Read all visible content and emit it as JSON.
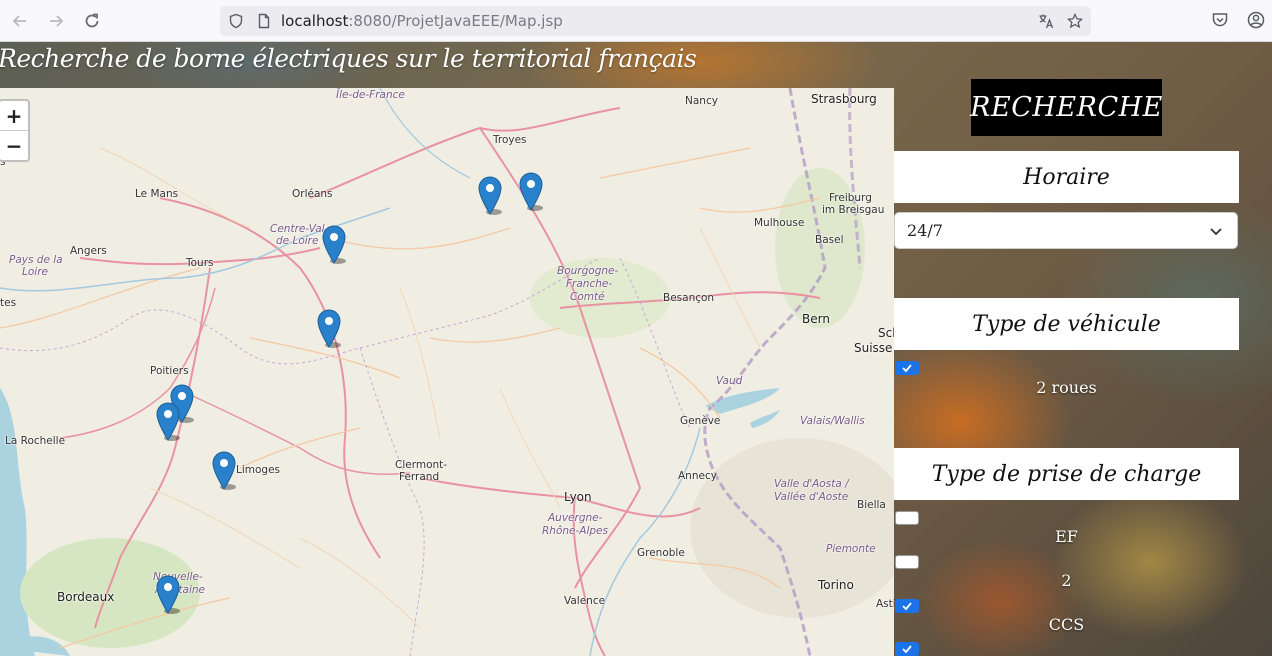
{
  "browser": {
    "url_host": "localhost",
    "url_rest": ":8080/ProjetJavaEEE/Map.jsp"
  },
  "page": {
    "title": "Recherche de borne électriques sur le territorial français"
  },
  "map": {
    "zoom_in": "+",
    "zoom_out": "−",
    "labels": {
      "ile_de_france": "Île-de-France",
      "nancy": "Nancy",
      "strasbourg": "Strasbourg",
      "troyes": "Troyes",
      "le_mans": "Le Mans",
      "orleans": "Orléans",
      "freiburg": "Freiburg",
      "breisgau": "im Breisgau",
      "mulhouse": "Mulhouse",
      "basel": "Basel",
      "angers": "Angers",
      "centre_1": "Centre-Val",
      "centre_2": "de Loire",
      "pays_1": "Pays de la",
      "pays_2": "Loire",
      "tours": "Tours",
      "bourgogne_1": "Bourgogne-",
      "bourgogne_2": "Franche-",
      "bourgogne_3": "Comté",
      "besancon": "Besançon",
      "nantes": "tes",
      "bern": "Bern",
      "schweiz_1": "Sch",
      "schweiz_2": "Suisse",
      "poitiers": "Poitiers",
      "vaud": "Vaud",
      "la_rochelle": "La Rochelle",
      "geneve": "Genève",
      "valais": "Valais/Wallis",
      "limoges": "Limoges",
      "clermont_1": "Clermont-",
      "clermont_2": "Ferrand",
      "annecy": "Annecy",
      "lyon": "Lyon",
      "aosta_1": "Valle d'Aosta /",
      "aosta_2": "Vallée d'Aoste",
      "biella": "Biella",
      "auvergne_1": "Auvergne-",
      "auvergne_2": "Rhône-Alpes",
      "grenoble": "Grenoble",
      "piemonte": "Piemonte",
      "nouvelle_1": "Nouvelle-",
      "nouvelle_2": "Aquitaine",
      "bordeaux": "Bordeaux",
      "valence": "Valence",
      "torino": "Torino",
      "asti": "Asti",
      "s_edge": "s"
    }
  },
  "panel": {
    "title": "RECHERCHE",
    "horaire": {
      "heading": "Horaire",
      "selected": "24/7"
    },
    "vehicule": {
      "heading": "Type de véhicule",
      "options": [
        {
          "label": "2 roues",
          "checked": true
        }
      ]
    },
    "prise": {
      "heading": "Type de prise de charge",
      "options": [
        {
          "label": "EF",
          "checked": false
        },
        {
          "label": "2",
          "checked": false
        },
        {
          "label": "CCS",
          "checked": true
        },
        {
          "label": "",
          "checked": true
        }
      ]
    }
  },
  "colors": {
    "accent": "#1a73e8",
    "marker": "#2a81cb"
  }
}
